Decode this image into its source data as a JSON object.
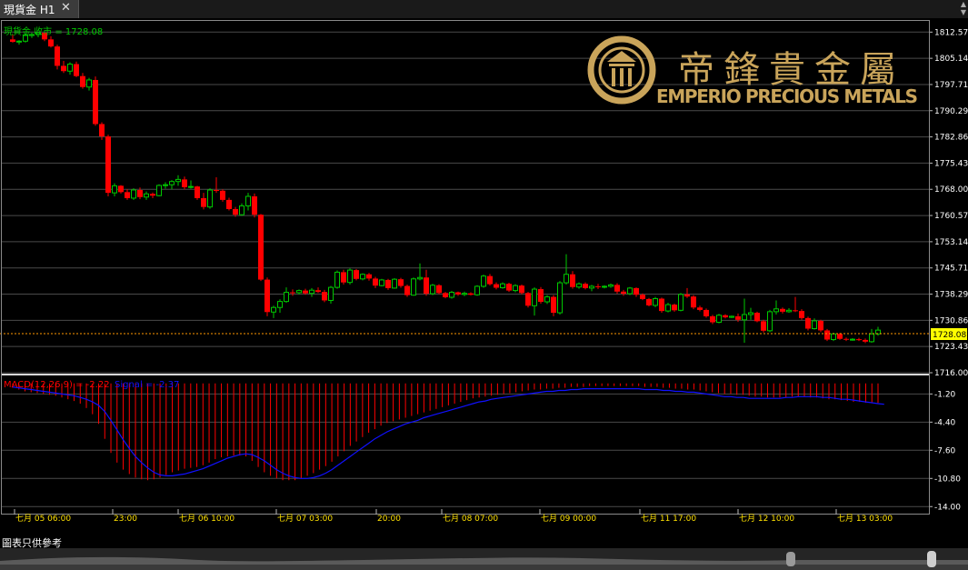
{
  "window": {
    "tab_label": "現貨金 H1",
    "close_symbol": "✕"
  },
  "logo": {
    "chinese_name": "帝鋒貴金屬",
    "english_name": "EMPERIO PRECIOUS METALS",
    "color": "#c9a45a"
  },
  "price_panel": {
    "header": "現貨金 收市 = 1728.08",
    "header_color": "#00c800",
    "current_price": "1728.08",
    "y_ticks": [
      "1812.57",
      "1805.14",
      "1797.71",
      "1790.29",
      "1782.86",
      "1775.43",
      "1768.00",
      "1760.57",
      "1753.14",
      "1745.71",
      "1738.29",
      "1730.86",
      "1723.43",
      "1716.00"
    ],
    "up_color": "#00c800",
    "down_color": "#ff0000"
  },
  "macd_panel": {
    "label": "MACD(12,26,9) = -2.22",
    "signal_label": "Signal = -2.37",
    "label_color": "#ff0000",
    "signal_color": "#1010ff",
    "y_ticks": [
      "-1.20",
      "-4.40",
      "-7.60",
      "-10.80",
      "-14.00"
    ]
  },
  "time_axis": [
    "七月 05 06:00",
    "23:00",
    "七月 06 10:00",
    "七月 07 03:00",
    "20:00",
    "七月 08 07:00",
    "七月 09 00:00",
    "七月 11 17:00",
    "七月 12 10:00",
    "七月 13 03:00"
  ],
  "footer_note": "圖表只供參考",
  "chart_data": [
    {
      "type": "candlestick",
      "title": "現貨金 H1",
      "ylim": [
        1716.0,
        1816.0
      ],
      "candles": [
        [
          1810.5,
          1811.8,
          1809.6,
          1809.8
        ],
        [
          1809.8,
          1810.3,
          1809.0,
          1810.0
        ],
        [
          1810.0,
          1812.2,
          1809.6,
          1811.6
        ],
        [
          1811.6,
          1812.4,
          1810.9,
          1811.9
        ],
        [
          1811.9,
          1812.6,
          1811.1,
          1812.4
        ],
        [
          1812.4,
          1812.5,
          1810.0,
          1810.5
        ],
        [
          1810.5,
          1811.4,
          1808.2,
          1808.5
        ],
        [
          1808.5,
          1809.0,
          1802.0,
          1803.0
        ],
        [
          1803.0,
          1804.4,
          1801.0,
          1801.5
        ],
        [
          1801.5,
          1804.0,
          1800.5,
          1803.5
        ],
        [
          1803.5,
          1804.2,
          1799.8,
          1800.1
        ],
        [
          1800.1,
          1801.0,
          1796.5,
          1797.0
        ],
        [
          1797.0,
          1799.6,
          1796.0,
          1799.0
        ],
        [
          1799.0,
          1800.0,
          1786.0,
          1786.5
        ],
        [
          1786.5,
          1787.0,
          1782.0,
          1783.0
        ],
        [
          1783.0,
          1783.5,
          1766.0,
          1767.0
        ],
        [
          1767.0,
          1769.7,
          1766.0,
          1769.0
        ],
        [
          1769.0,
          1769.2,
          1766.8,
          1767.2
        ],
        [
          1767.2,
          1768.0,
          1765.0,
          1765.5
        ],
        [
          1765.5,
          1768.3,
          1765.0,
          1767.8
        ],
        [
          1767.8,
          1768.5,
          1765.2,
          1765.8
        ],
        [
          1765.8,
          1767.4,
          1765.0,
          1766.7
        ],
        [
          1766.7,
          1767.1,
          1765.5,
          1766.2
        ],
        [
          1766.2,
          1769.4,
          1766.0,
          1769.1
        ],
        [
          1769.1,
          1770.0,
          1768.2,
          1769.3
        ],
        [
          1769.3,
          1770.6,
          1768.0,
          1770.2
        ],
        [
          1770.2,
          1772.0,
          1769.0,
          1770.8
        ],
        [
          1770.8,
          1771.6,
          1768.0,
          1768.6
        ],
        [
          1768.6,
          1770.5,
          1768.2,
          1768.8
        ],
        [
          1768.8,
          1769.0,
          1765.0,
          1765.5
        ],
        [
          1765.5,
          1767.0,
          1762.3,
          1763.0
        ],
        [
          1763.0,
          1768.3,
          1762.5,
          1767.8
        ],
        [
          1767.8,
          1771.4,
          1767.0,
          1767.6
        ],
        [
          1767.6,
          1768.0,
          1764.5,
          1765.0
        ],
        [
          1765.0,
          1765.6,
          1762.0,
          1762.4
        ],
        [
          1762.4,
          1763.0,
          1760.2,
          1760.8
        ],
        [
          1760.8,
          1764.0,
          1760.5,
          1763.3
        ],
        [
          1763.3,
          1767.0,
          1762.0,
          1766.0
        ],
        [
          1766.0,
          1766.8,
          1760.0,
          1760.8
        ],
        [
          1760.8,
          1761.0,
          1742.0,
          1742.4
        ],
        [
          1742.4,
          1743.0,
          1732.0,
          1733.2
        ],
        [
          1733.2,
          1735.0,
          1731.5,
          1734.5
        ],
        [
          1734.5,
          1736.8,
          1733.0,
          1736.2
        ],
        [
          1736.2,
          1740.2,
          1735.8,
          1738.8
        ],
        [
          1738.8,
          1739.6,
          1737.8,
          1738.7
        ],
        [
          1738.7,
          1739.6,
          1738.2,
          1739.3
        ],
        [
          1739.3,
          1739.8,
          1738.1,
          1738.5
        ],
        [
          1738.5,
          1740.0,
          1737.5,
          1739.4
        ],
        [
          1739.4,
          1740.2,
          1738.6,
          1738.9
        ],
        [
          1738.9,
          1739.5,
          1736.0,
          1736.5
        ],
        [
          1736.5,
          1740.6,
          1735.6,
          1740.2
        ],
        [
          1740.2,
          1745.0,
          1739.8,
          1744.5
        ],
        [
          1744.5,
          1745.2,
          1741.0,
          1741.6
        ],
        [
          1741.6,
          1745.6,
          1741.0,
          1745.1
        ],
        [
          1745.1,
          1745.4,
          1742.2,
          1742.6
        ],
        [
          1742.6,
          1744.2,
          1742.2,
          1743.9
        ],
        [
          1743.9,
          1744.3,
          1742.1,
          1742.7
        ],
        [
          1742.7,
          1743.2,
          1740.0,
          1740.7
        ],
        [
          1740.7,
          1742.6,
          1740.5,
          1742.3
        ],
        [
          1742.3,
          1742.6,
          1739.5,
          1740.0
        ],
        [
          1740.0,
          1742.8,
          1739.8,
          1742.5
        ],
        [
          1742.5,
          1742.9,
          1740.1,
          1740.6
        ],
        [
          1740.6,
          1741.0,
          1737.5,
          1738.0
        ],
        [
          1738.0,
          1743.0,
          1737.8,
          1742.6
        ],
        [
          1742.6,
          1747.0,
          1742.2,
          1743.0
        ],
        [
          1743.0,
          1745.2,
          1737.8,
          1738.4
        ],
        [
          1738.4,
          1741.2,
          1738.0,
          1740.8
        ],
        [
          1740.8,
          1741.1,
          1738.3,
          1738.6
        ],
        [
          1738.6,
          1738.9,
          1737.1,
          1737.4
        ],
        [
          1737.4,
          1739.2,
          1737.0,
          1738.8
        ],
        [
          1738.8,
          1739.0,
          1737.8,
          1738.2
        ],
        [
          1738.2,
          1739.0,
          1737.7,
          1738.5
        ],
        [
          1738.5,
          1738.8,
          1737.9,
          1738.1
        ],
        [
          1738.1,
          1740.8,
          1737.8,
          1740.5
        ],
        [
          1740.5,
          1743.8,
          1740.1,
          1743.4
        ],
        [
          1743.4,
          1744.0,
          1740.7,
          1741.1
        ],
        [
          1741.1,
          1741.6,
          1739.6,
          1740.1
        ],
        [
          1740.1,
          1741.6,
          1739.8,
          1741.2
        ],
        [
          1741.2,
          1741.5,
          1738.9,
          1739.3
        ],
        [
          1739.3,
          1741.1,
          1738.8,
          1740.7
        ],
        [
          1740.7,
          1741.0,
          1738.2,
          1738.6
        ],
        [
          1738.6,
          1738.9,
          1734.5,
          1735.0
        ],
        [
          1735.0,
          1740.2,
          1732.2,
          1739.7
        ],
        [
          1739.7,
          1740.3,
          1735.6,
          1736.1
        ],
        [
          1736.1,
          1738.0,
          1735.5,
          1737.5
        ],
        [
          1737.5,
          1738.0,
          1732.0,
          1733.0
        ],
        [
          1733.0,
          1742.0,
          1732.5,
          1741.5
        ],
        [
          1741.5,
          1749.6,
          1741.0,
          1743.9
        ],
        [
          1743.9,
          1744.8,
          1739.8,
          1740.3
        ],
        [
          1740.3,
          1741.6,
          1739.8,
          1741.2
        ],
        [
          1741.2,
          1741.6,
          1739.6,
          1740.0
        ],
        [
          1740.0,
          1740.9,
          1739.1,
          1740.5
        ],
        [
          1740.5,
          1741.2,
          1739.7,
          1740.4
        ],
        [
          1740.4,
          1740.8,
          1739.9,
          1740.5
        ],
        [
          1740.5,
          1741.3,
          1740.1,
          1740.9
        ],
        [
          1740.9,
          1741.4,
          1738.4,
          1739.0
        ],
        [
          1739.0,
          1739.5,
          1737.8,
          1738.4
        ],
        [
          1738.4,
          1740.3,
          1738.0,
          1740.0
        ],
        [
          1740.0,
          1740.2,
          1737.5,
          1738.1
        ],
        [
          1738.1,
          1738.5,
          1736.6,
          1736.9
        ],
        [
          1736.9,
          1737.2,
          1734.8,
          1735.1
        ],
        [
          1735.1,
          1737.5,
          1734.6,
          1737.0
        ],
        [
          1737.0,
          1737.3,
          1733.0,
          1733.5
        ],
        [
          1733.5,
          1735.8,
          1733.1,
          1735.3
        ],
        [
          1735.3,
          1735.6,
          1733.3,
          1733.7
        ],
        [
          1733.7,
          1738.6,
          1733.4,
          1738.2
        ],
        [
          1738.2,
          1740.0,
          1737.2,
          1737.6
        ],
        [
          1737.6,
          1738.0,
          1734.0,
          1734.5
        ],
        [
          1734.5,
          1735.0,
          1733.4,
          1733.8
        ],
        [
          1733.8,
          1734.2,
          1731.6,
          1732.0
        ],
        [
          1732.0,
          1732.4,
          1729.8,
          1730.3
        ],
        [
          1730.3,
          1732.7,
          1730.0,
          1732.3
        ],
        [
          1732.3,
          1732.6,
          1731.4,
          1731.7
        ],
        [
          1731.7,
          1732.2,
          1731.5,
          1732.0
        ],
        [
          1732.0,
          1732.8,
          1730.4,
          1731.0
        ],
        [
          1731.0,
          1737.0,
          1724.5,
          1732.5
        ],
        [
          1732.5,
          1734.4,
          1731.0,
          1733.0
        ],
        [
          1733.0,
          1733.3,
          1730.3,
          1730.6
        ],
        [
          1730.6,
          1731.0,
          1727.4,
          1727.9
        ],
        [
          1727.9,
          1733.8,
          1727.5,
          1733.3
        ],
        [
          1733.3,
          1736.5,
          1732.5,
          1734.1
        ],
        [
          1734.1,
          1734.5,
          1732.8,
          1733.3
        ],
        [
          1733.3,
          1734.3,
          1733.0,
          1733.7
        ],
        [
          1733.7,
          1737.5,
          1733.2,
          1733.5
        ],
        [
          1733.5,
          1734.0,
          1731.0,
          1731.5
        ],
        [
          1731.5,
          1731.9,
          1728.0,
          1728.5
        ],
        [
          1728.5,
          1731.4,
          1728.2,
          1730.7
        ],
        [
          1730.7,
          1731.0,
          1727.5,
          1728.0
        ],
        [
          1728.0,
          1728.4,
          1725.0,
          1725.4
        ],
        [
          1725.4,
          1727.3,
          1725.0,
          1727.0
        ],
        [
          1727.0,
          1727.3,
          1725.3,
          1725.6
        ],
        [
          1725.6,
          1726.0,
          1725.0,
          1725.5
        ],
        [
          1725.5,
          1725.8,
          1725.1,
          1725.5
        ],
        [
          1725.5,
          1725.9,
          1725.0,
          1725.3
        ],
        [
          1725.3,
          1725.7,
          1724.4,
          1724.8
        ],
        [
          1724.8,
          1728.4,
          1724.5,
          1727.0
        ],
        [
          1727.0,
          1729.0,
          1726.5,
          1728.08
        ]
      ]
    },
    {
      "type": "bar",
      "title": "MACD(12,26,9)",
      "ylim": [
        -14.8,
        0.8
      ],
      "series": [
        {
          "name": "MACD(12,26,9)",
          "values": [
            -0.5,
            -0.7,
            -0.9,
            -1.0,
            -1.1,
            -1.2,
            -1.3,
            -1.4,
            -1.6,
            -1.8,
            -2.0,
            -2.3,
            -2.8,
            -3.5,
            -4.6,
            -6.3,
            -7.9,
            -9.0,
            -9.8,
            -10.3,
            -10.7,
            -10.9,
            -11.0,
            -10.9,
            -10.7,
            -10.4,
            -10.1,
            -9.9,
            -9.7,
            -9.6,
            -9.5,
            -9.3,
            -9.0,
            -8.6,
            -8.4,
            -8.3,
            -8.2,
            -8.2,
            -8.3,
            -8.8,
            -9.5,
            -10.1,
            -10.5,
            -10.8,
            -11.0,
            -11.0,
            -11.0,
            -10.8,
            -10.5,
            -10.2,
            -9.8,
            -9.4,
            -8.9,
            -8.3,
            -7.7,
            -7.1,
            -6.6,
            -6.1,
            -5.6,
            -5.2,
            -4.8,
            -4.5,
            -4.3,
            -4.1,
            -3.9,
            -3.7,
            -3.5,
            -3.3,
            -3.1,
            -2.9,
            -2.7,
            -2.5,
            -2.3,
            -2.1,
            -1.9,
            -1.7,
            -1.6,
            -1.5,
            -1.4,
            -1.3,
            -1.2,
            -1.1,
            -1.0,
            -0.9,
            -0.8,
            -0.7,
            -0.7,
            -0.6,
            -0.6,
            -0.5,
            -0.5,
            -0.4,
            -0.4,
            -0.4,
            -0.3,
            -0.3,
            -0.3,
            -0.3,
            -0.3,
            -0.3,
            -0.3,
            -0.3,
            -0.3,
            -0.4,
            -0.4,
            -0.4,
            -0.5,
            -0.5,
            -0.6,
            -0.6,
            -0.7,
            -0.7,
            -0.8,
            -0.9,
            -1.0,
            -1.1,
            -1.2,
            -1.2,
            -1.3,
            -1.3,
            -1.4,
            -1.5,
            -1.5,
            -1.6,
            -1.6,
            -1.6,
            -1.6,
            -1.5,
            -1.5,
            -1.5,
            -1.6,
            -1.6,
            -1.7,
            -1.8,
            -1.8,
            -1.9,
            -2.0,
            -2.1,
            -2.1,
            -2.2,
            -2.2,
            -2.22
          ]
        },
        {
          "name": "Signal",
          "values": [
            -0.4,
            -0.5,
            -0.6,
            -0.7,
            -0.8,
            -0.9,
            -1.0,
            -1.1,
            -1.2,
            -1.3,
            -1.4,
            -1.6,
            -1.8,
            -2.1,
            -2.5,
            -3.2,
            -4.2,
            -5.3,
            -6.4,
            -7.4,
            -8.3,
            -9.0,
            -9.6,
            -10.1,
            -10.4,
            -10.5,
            -10.5,
            -10.4,
            -10.3,
            -10.1,
            -9.9,
            -9.7,
            -9.4,
            -9.1,
            -8.8,
            -8.5,
            -8.3,
            -8.1,
            -8.0,
            -8.1,
            -8.4,
            -8.8,
            -9.3,
            -9.8,
            -10.2,
            -10.5,
            -10.7,
            -10.8,
            -10.8,
            -10.7,
            -10.5,
            -10.2,
            -9.8,
            -9.3,
            -8.8,
            -8.3,
            -7.8,
            -7.3,
            -6.8,
            -6.3,
            -5.9,
            -5.5,
            -5.2,
            -4.9,
            -4.6,
            -4.4,
            -4.2,
            -3.9,
            -3.7,
            -3.5,
            -3.3,
            -3.1,
            -2.9,
            -2.7,
            -2.5,
            -2.3,
            -2.1,
            -2.0,
            -1.8,
            -1.7,
            -1.6,
            -1.5,
            -1.4,
            -1.3,
            -1.2,
            -1.1,
            -1.0,
            -0.9,
            -0.9,
            -0.8,
            -0.8,
            -0.7,
            -0.7,
            -0.6,
            -0.6,
            -0.6,
            -0.6,
            -0.6,
            -0.6,
            -0.6,
            -0.6,
            -0.6,
            -0.6,
            -0.7,
            -0.7,
            -0.7,
            -0.8,
            -0.8,
            -0.9,
            -0.9,
            -1.0,
            -1.0,
            -1.1,
            -1.2,
            -1.3,
            -1.4,
            -1.5,
            -1.5,
            -1.6,
            -1.6,
            -1.7,
            -1.7,
            -1.7,
            -1.7,
            -1.7,
            -1.7,
            -1.6,
            -1.6,
            -1.5,
            -1.5,
            -1.5,
            -1.5,
            -1.6,
            -1.6,
            -1.7,
            -1.8,
            -1.8,
            -1.9,
            -2.0,
            -2.1,
            -2.2,
            -2.3,
            -2.37
          ]
        }
      ]
    }
  ]
}
